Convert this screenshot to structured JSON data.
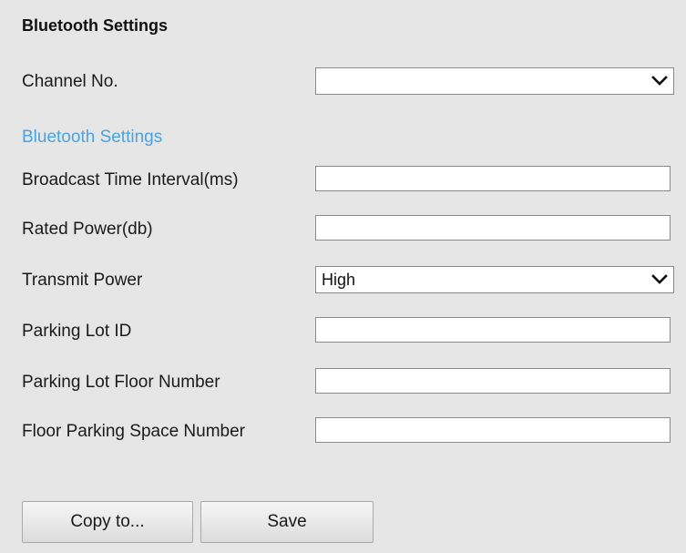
{
  "panel": {
    "title": "Bluetooth Settings",
    "section_title": "Bluetooth Settings"
  },
  "fields": {
    "channel_no": {
      "label": "Channel No.",
      "value": ""
    },
    "broadcast_interval": {
      "label": "Broadcast Time Interval(ms)",
      "value": ""
    },
    "rated_power": {
      "label": "Rated Power(db)",
      "value": ""
    },
    "transmit_power": {
      "label": "Transmit Power",
      "value": "High"
    },
    "parking_lot_id": {
      "label": "Parking Lot ID",
      "value": ""
    },
    "parking_lot_floor": {
      "label": "Parking Lot Floor Number",
      "value": ""
    },
    "floor_space_number": {
      "label": "Floor Parking Space Number",
      "value": ""
    }
  },
  "buttons": {
    "copy_to": "Copy to...",
    "save": "Save"
  },
  "icons": {
    "dropdown": "chevron-down-icon"
  },
  "colors": {
    "background": "#e6e6e6",
    "section_accent": "#4aa3df"
  }
}
